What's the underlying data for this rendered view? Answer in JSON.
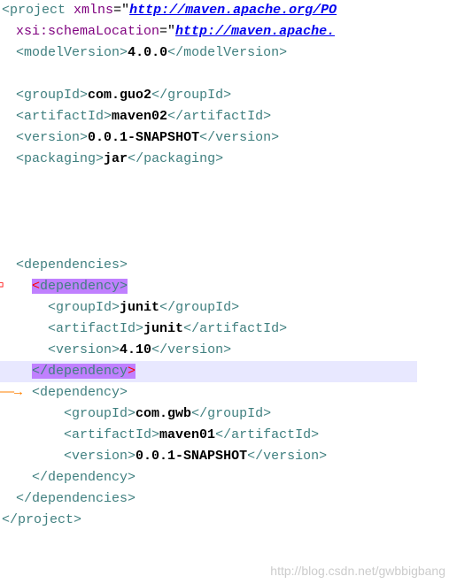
{
  "lines": {
    "l1_open": "<",
    "l1_tag": "project",
    "l1_sp": " ",
    "l1_attr": "xmlns",
    "l1_eq": "=\"",
    "l1_link": "http://maven.apache.org/PO",
    "l2_attr": "xsi:schemaLocation",
    "l2_eq": "=\"",
    "l2_link": "http://maven.apache.",
    "l3_open": "<",
    "l3_tag": "modelVersion",
    "l3_close": ">",
    "l3_val": "4.0.0",
    "l3_open2": "</",
    "l3_tag2": "modelVersion",
    "l3_close2": ">",
    "l5_open": "<",
    "l5_tag": "groupId",
    "l5_close": ">",
    "l5_val": "com.guo2",
    "l5_open2": "</",
    "l5_tag2": "groupId",
    "l5_close2": ">",
    "l6_open": "<",
    "l6_tag": "artifactId",
    "l6_close": ">",
    "l6_val": "maven02",
    "l6_open2": "</",
    "l6_tag2": "artifactId",
    "l6_close2": ">",
    "l7_open": "<",
    "l7_tag": "version",
    "l7_close": ">",
    "l7_val": "0.0.1-SNAPSHOT",
    "l7_open2": "</",
    "l7_tag2": "version",
    "l7_close2": ">",
    "l8_open": "<",
    "l8_tag": "packaging",
    "l8_close": ">",
    "l8_val": "jar",
    "l8_open2": "</",
    "l8_tag2": "packaging",
    "l8_close2": ">",
    "l13_open": "<",
    "l13_tag": "dependencies",
    "l13_close": ">",
    "l14_open": "<",
    "l14_tag": "dependency",
    "l14_close": ">",
    "l15_open": "<",
    "l15_tag": "groupId",
    "l15_close": ">",
    "l15_val": "junit",
    "l15_open2": "</",
    "l15_tag2": "groupId",
    "l15_close2": ">",
    "l16_open": "<",
    "l16_tag": "artifactId",
    "l16_close": ">",
    "l16_val": "junit",
    "l16_open2": "</",
    "l16_tag2": "artifactId",
    "l16_close2": ">",
    "l17_open": "<",
    "l17_tag": "version",
    "l17_close": ">",
    "l17_val": "4.10",
    "l17_open2": "</",
    "l17_tag2": "version",
    "l17_close2": ">",
    "l18_open": "</",
    "l18_tag1": "depe",
    "l18_tag2": "ndency",
    "l18_close": ">",
    "l19_open": "<",
    "l19_tag": "dependency",
    "l19_close": ">",
    "l20_open": "<",
    "l20_tag": "groupId",
    "l20_close": ">",
    "l20_val": "com.gwb",
    "l20_open2": "</",
    "l20_tag2": "groupId",
    "l20_close2": ">",
    "l21_open": "<",
    "l21_tag": "artifactId",
    "l21_close": ">",
    "l21_val": "maven01",
    "l21_open2": "</",
    "l21_tag2": "artifactId",
    "l21_close2": ">",
    "l22_open": "<",
    "l22_tag": "version",
    "l22_close": ">",
    "l22_val": "0.0.1-SNAPSHOT",
    "l22_open2": "</",
    "l22_tag2": "version",
    "l22_close2": ">",
    "l23_open": "</",
    "l23_tag": "dependency",
    "l23_close": ">",
    "l24_open": "</",
    "l24_tag": "dependencies",
    "l24_close": ">",
    "l25_open": "</",
    "l25_tag": "project",
    "l25_close": ">"
  },
  "watermark": "http://blog.csdn.net/gwbbigbang",
  "arrow_glyph": "――→"
}
